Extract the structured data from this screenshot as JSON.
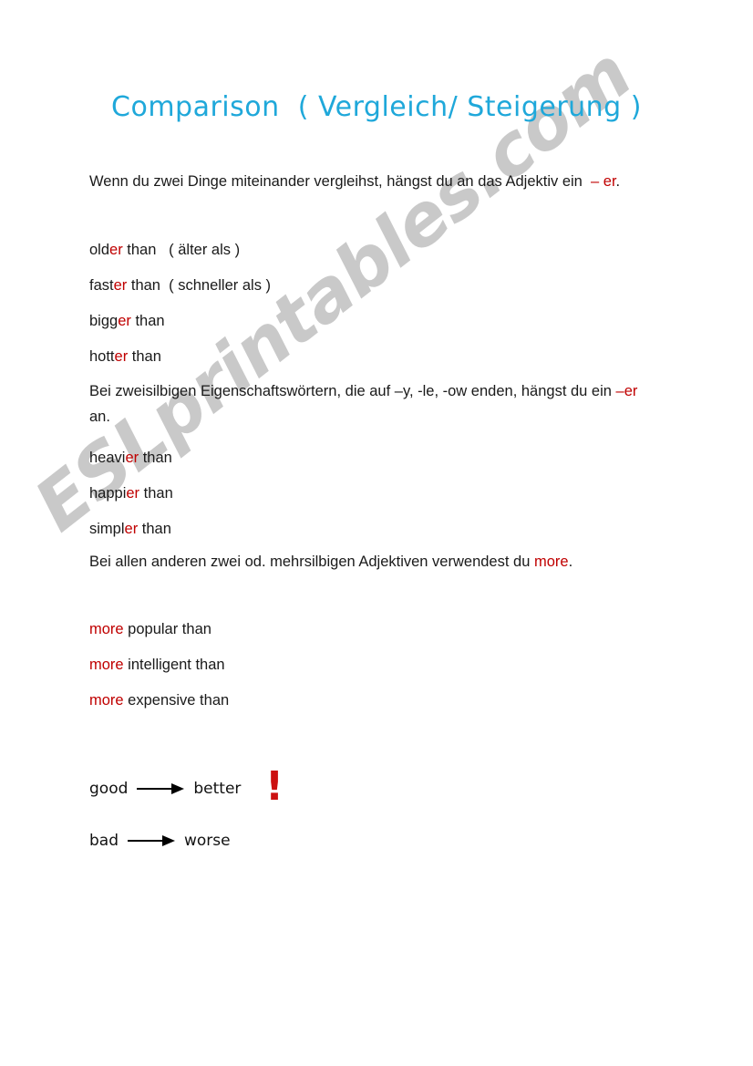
{
  "document": {
    "title": "Comparison  ( Vergleich/ Steigerung )",
    "watermark": "ESLprintables.com",
    "colors": {
      "title": "#1fa8da",
      "highlight_red": "#c00000",
      "exclamation_red": "#cc1111",
      "body_text": "#1a1a1a",
      "watermark": "#c9c9c9",
      "page_background": "#ffffff"
    }
  },
  "sections": {
    "rule_one": {
      "paragraph_part1": "Wenn du zwei Dinge miteinander vergleihst, hängst du an das Adjektiv ein ",
      "paragraph_suffix": " – er",
      "paragraph_end": ".",
      "examples": [
        {
          "stem": "old",
          "ending": "er",
          "tail": " than",
          "translation": "   ( älter als )"
        },
        {
          "stem": "fast",
          "ending": "er",
          "tail": " than",
          "translation": "  ( schneller als )"
        },
        {
          "stem": "bigg",
          "ending": "er",
          "tail": " than",
          "translation": ""
        },
        {
          "stem": "hott",
          "ending": "er",
          "tail": " than",
          "translation": ""
        }
      ]
    },
    "rule_two": {
      "paragraph_part1": "Bei zweisilbigen Eigenschaftswörtern, die auf –y, -le, -ow enden, hängst du ein ",
      "paragraph_suffix": "–er",
      "paragraph_end": " an.",
      "examples": [
        {
          "stem": "heavi",
          "ending": "er",
          "tail": " than",
          "translation": ""
        },
        {
          "stem": "happi",
          "ending": "er",
          "tail": " than",
          "translation": ""
        },
        {
          "stem": "simpl",
          "ending": "er",
          "tail": " than",
          "translation": ""
        }
      ]
    },
    "rule_three": {
      "paragraph_part1": "Bei allen anderen zwei od. mehrsilbigen Adjektiven verwendest du ",
      "paragraph_suffix": "more",
      "paragraph_end": ".",
      "examples": [
        {
          "stem": "more",
          "ending": "",
          "tail": " popular than",
          "translation": ""
        },
        {
          "stem": "more",
          "ending": "",
          "tail": " intelligent than",
          "translation": ""
        },
        {
          "stem": "more",
          "ending": "",
          "tail": " expensive than",
          "translation": ""
        }
      ]
    },
    "irregulars": {
      "exclamation": "!",
      "rows": [
        {
          "base": "good",
          "comparative": "better"
        },
        {
          "base": "bad",
          "comparative": "worse"
        }
      ]
    }
  }
}
